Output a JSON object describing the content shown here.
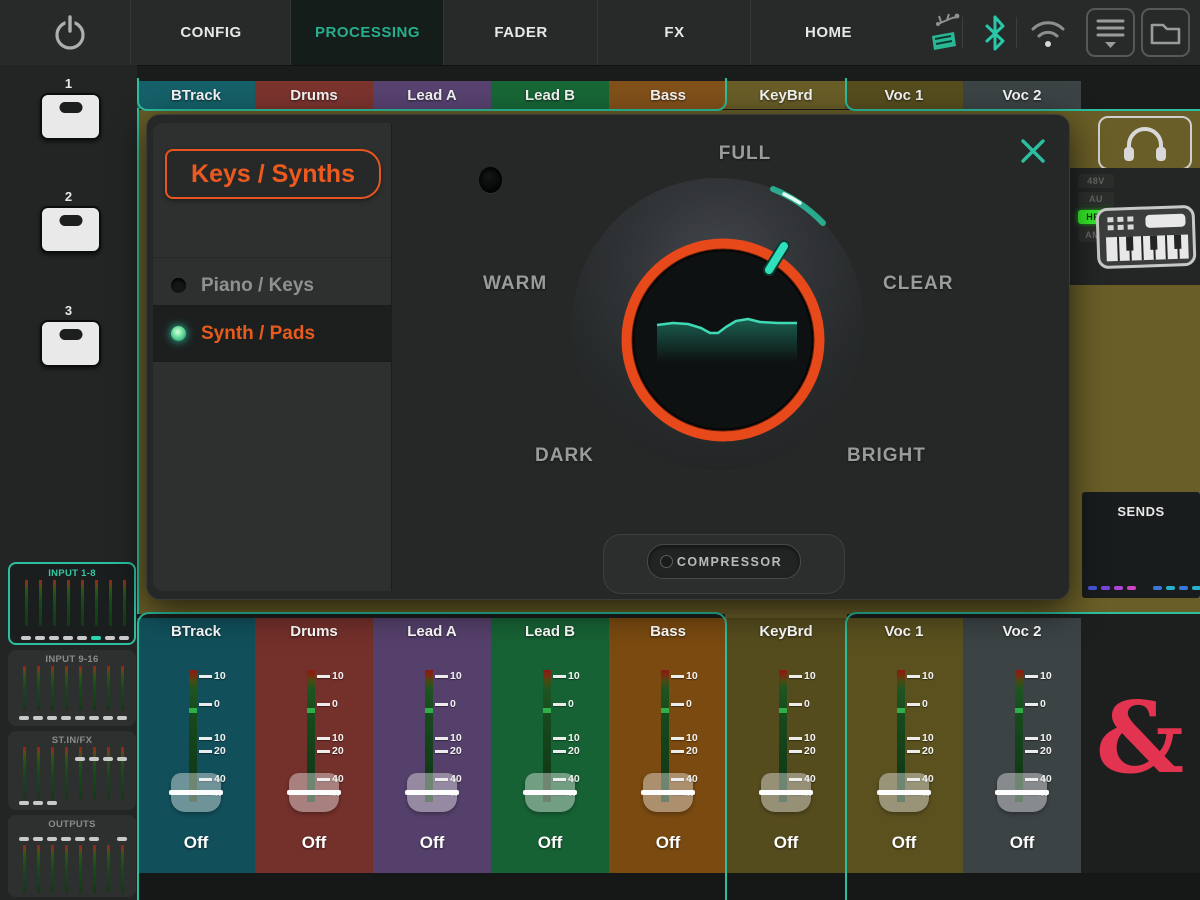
{
  "topbar": {
    "tabs": [
      {
        "label": "CONFIG",
        "active": false
      },
      {
        "label": "PROCESSING",
        "active": true
      },
      {
        "label": "FADER",
        "active": false
      },
      {
        "label": "FX",
        "active": false
      },
      {
        "label": "HOME",
        "active": false
      }
    ],
    "status_icons": [
      "usb-device-icon",
      "bluetooth-icon",
      "wifi-icon"
    ],
    "scene_button": "scene-list-button",
    "library_button": "folder-button"
  },
  "sidebar": {
    "softkeys": [
      "1",
      "2",
      "3"
    ],
    "meter_panels": [
      {
        "title": "INPUT 1-8",
        "selected": true
      },
      {
        "title": "INPUT 9-16",
        "selected": false
      },
      {
        "title": "ST.IN/FX",
        "selected": false
      },
      {
        "title": "OUTPUTS",
        "selected": false
      }
    ]
  },
  "channels": [
    {
      "name": "BTrack",
      "tab_color": "#156069",
      "strip_color": "#11505b",
      "fader": "Off"
    },
    {
      "name": "Drums",
      "tab_color": "#7b332e",
      "strip_color": "#74302b",
      "fader": "Off"
    },
    {
      "name": "Lead A",
      "tab_color": "#584270",
      "strip_color": "#55406b",
      "fader": "Off"
    },
    {
      "name": "Lead B",
      "tab_color": "#186737",
      "strip_color": "#176235",
      "fader": "Off"
    },
    {
      "name": "Bass",
      "tab_color": "#82511a",
      "strip_color": "#7a4a10",
      "fader": "Off"
    },
    {
      "name": "KeyBrd",
      "tab_color": "#695e27",
      "strip_color": "#554c1e",
      "fader": "Off",
      "selected": true
    },
    {
      "name": "Voc 1",
      "tab_color": "#564d1e",
      "strip_color": "#5a511f",
      "fader": "Off"
    },
    {
      "name": "Voc 2",
      "tab_color": "#3c4345",
      "strip_color": "#3c4345",
      "fader": "Off"
    }
  ],
  "fader_scale": [
    "10",
    "0",
    "10",
    "20",
    "40",
    "∞"
  ],
  "dialog": {
    "title": "Keys / Synths",
    "options": [
      {
        "label": "Piano / Keys",
        "selected": false
      },
      {
        "label": "Synth / Pads",
        "selected": true
      }
    ],
    "knob_labels": {
      "top": "FULL",
      "left": "WARM",
      "right": "CLEAR",
      "bottom_left": "DARK",
      "bottom_right": "BRIGHT"
    },
    "compressor_label": "COMPRESSOR"
  },
  "right_panel": {
    "preamp_badges": [
      {
        "label": "48V",
        "active": false
      },
      {
        "label": "AU",
        "active": false
      },
      {
        "label": "HPF",
        "active": true
      },
      {
        "label": "AMP",
        "active": false
      }
    ],
    "sends_label": "SENDS",
    "sends_dash_colors": [
      "#4455d8",
      "#7a44d8",
      "#b044d8",
      "#cc44c0",
      null,
      "#3a78d8",
      "#28b0c8",
      "#3a78d8",
      "#28b0c8"
    ]
  },
  "logo": "&",
  "colors": {
    "accent_teal": "#2bbf9f",
    "active_tab_text": "#27ae8c",
    "orange": "#ea5a1c",
    "knob_ring": "#e8491a",
    "page_olive": "#695e27",
    "logo_red": "#e23450",
    "selected_dash": "#2bd4ae"
  }
}
